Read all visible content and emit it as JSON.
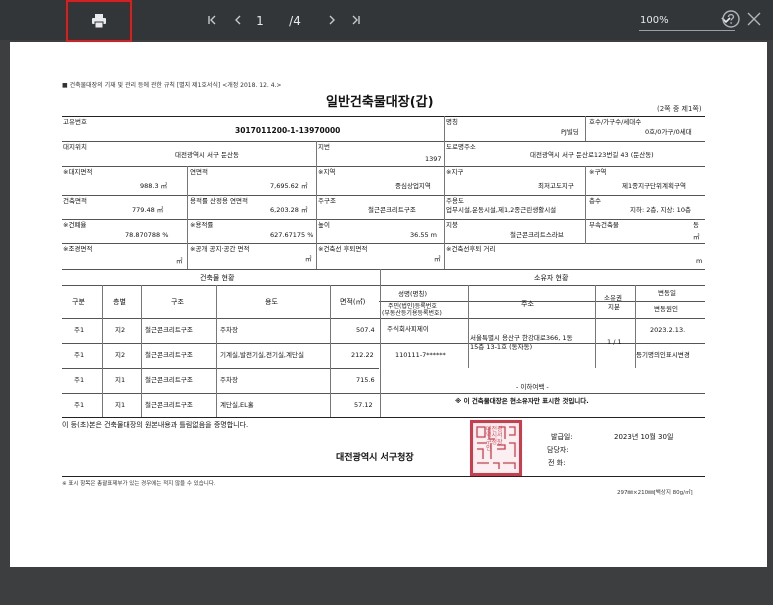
{
  "toolbar": {
    "page_current": "1",
    "page_total": "/4",
    "zoom": "100%",
    "icons": [
      "print-icon",
      "first-page-icon",
      "prev-page-icon",
      "next-page-icon",
      "last-page-icon",
      "zoom-dropdown-icon",
      "help-icon",
      "close-icon"
    ]
  },
  "doc": {
    "rule_ref": "■ 건축물대장의 기재 및 관리 등에 관한 규칙 [별지 제1호서식] <개정 2018. 12. 4.>",
    "title": "일반건축물대장(갑)",
    "page_of": "(2쪽 중 제1쪽)",
    "row1": {
      "id_label": "고유번호",
      "id_value": "3017011200-1-13970000",
      "name_label": "명칭",
      "name_value": "PJ빌딩",
      "units_label": "호수/가구수/세대수",
      "units_value": "0호/0가구/0세대"
    },
    "row2": {
      "site_label": "대지위치",
      "site_value": "대전광역시 서구 둔산동",
      "lot_label": "지번",
      "lot_value": "1397",
      "road_label": "도로명주소",
      "road_value": "대전광역시 서구 둔산로123번길 43 (둔산동)"
    },
    "row3": {
      "land_area_label": "※대지면적",
      "land_area_value": "988.3 ㎡",
      "floor_area_label": "연면적",
      "floor_area_value": "7,695.62 ㎡",
      "zone_label": "※지역",
      "zone_value": "중심상업지역",
      "district_label": "※지구",
      "district_value": "최저고도지구",
      "area_label": "※구역",
      "area_value": "제1종지구단위계획구역"
    },
    "row4": {
      "bldg_area_label": "건축면적",
      "bldg_area_value": "779.48 ㎡",
      "far_area_label": "용적률 산정용 연면적",
      "far_area_value": "6,203.28 ㎡",
      "structure_label": "주구조",
      "structure_value": "철근콘크리트구조",
      "use_label": "주용도",
      "use_value": "업무시설,운동시설,제1,2종근린생활시설",
      "floors_label": "층수",
      "floors_value": "지하: 2층, 지상: 10층"
    },
    "row5": {
      "bcr_label": "※건폐율",
      "bcr_value": "78.870788 %",
      "far_label": "※용적률",
      "far_value": "627.67175 %",
      "height_label": "높이",
      "height_value": "36.55 m",
      "roof_label": "지붕",
      "roof_value": "철근콘크리트스라브",
      "annex_label": "부속건축물",
      "annex_value": "동",
      "annex_unit": "㎡"
    },
    "row6": {
      "landscape_label": "※조경면적",
      "landscape_unit": "㎡",
      "public_label": "※공개 공지·공간 면적",
      "public_unit": "㎡",
      "setback_area_label": "※건축선 후퇴면적",
      "setback_area_unit": "㎡",
      "setback_dist_label": "※건축선후퇴 거리",
      "setback_dist_unit": "m"
    },
    "building_status": {
      "header": "건축물 현황",
      "columns": [
        "구분",
        "층별",
        "구조",
        "용도",
        "면적(㎡)"
      ],
      "rows": [
        {
          "kind": "주1",
          "floor": "지2",
          "structure": "철근콘크리트구조",
          "use": "주차장",
          "area": "507.4"
        },
        {
          "kind": "주1",
          "floor": "지2",
          "structure": "철근콘크리트구조",
          "use": "기계실,발전기실,전기실,계단실",
          "area": "212.22"
        },
        {
          "kind": "주1",
          "floor": "지1",
          "structure": "철근콘크리트구조",
          "use": "주차장",
          "area": "715.6"
        },
        {
          "kind": "주1",
          "floor": "지1",
          "structure": "철근콘크리트구조",
          "use": "계단실,EL홀",
          "area": "57.12"
        }
      ]
    },
    "owner_status": {
      "header": "소유자 현황",
      "name_header": "성명(명칭)",
      "reg_header_1": "주민(법인)등록번호",
      "reg_header_2": "(부동산등기용등록번호)",
      "address_header": "주소",
      "share_header_1": "소유권",
      "share_header_2": "지분",
      "change_date_header": "변동일",
      "change_reason_header": "변동원인",
      "owner_name": "주식회사피제이",
      "owner_reg": "110111-7******",
      "owner_address_1": "서울특별시 용산구 한강대로366, 1동",
      "owner_address_2": "15층 13-1호 (동자동)",
      "owner_share": "1 / 1",
      "change_date": "2023.2.13.",
      "change_reason": "등기명의인표시변경",
      "below": "- 이하여백 -",
      "note": "※ 이 건축물대장은 현소유자만 표시한 것입니다."
    },
    "certify": "이 등(초)본은 건축물대장의 원본내용과 틀림없음을 증명합니다.",
    "issuer": "대전광역시 서구청장",
    "issue_date_label": "발급일:",
    "issue_date": "2023년 10월 30일",
    "staff_label": "담당자:",
    "phone_label": "전  화:",
    "seal_text": "대전광역시서구청장인",
    "footnote": "※ 표시 항목은 총괄표제부가 있는 경우에는 적지 않을 수 있습니다.",
    "paper_size": "297㎜×210㎜[백상지 80g/㎡]"
  }
}
